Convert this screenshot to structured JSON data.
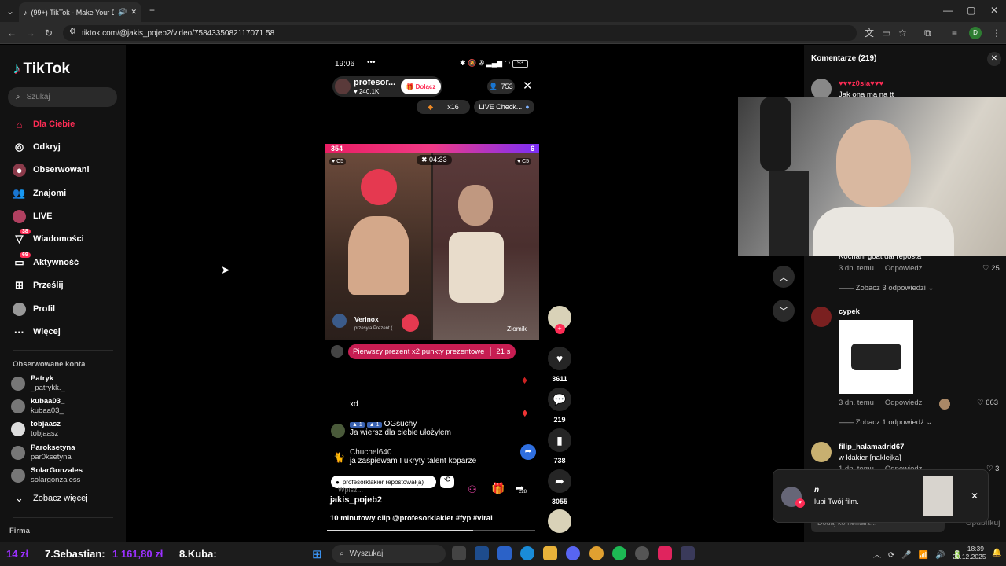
{
  "browser": {
    "tab_title": "(99+) TikTok - Make Your Da",
    "url": "tiktok.com/@jakis_pojeb2/video/7584335082117071 58",
    "new_tab": "+"
  },
  "sidebar": {
    "logo": "TikTok",
    "search_placeholder": "Szukaj",
    "nav": [
      {
        "label": "Dla Ciebie"
      },
      {
        "label": "Odkryj"
      },
      {
        "label": "Obserwowani"
      },
      {
        "label": "Znajomi"
      },
      {
        "label": "LIVE"
      },
      {
        "label": "Wiadomości",
        "badge": "38"
      },
      {
        "label": "Aktywność",
        "badge": "69"
      },
      {
        "label": "Prześlij"
      },
      {
        "label": "Profil"
      },
      {
        "label": "Więcej"
      }
    ],
    "followed_title": "Obserwowane konta",
    "accounts": [
      {
        "name": "Patryk",
        "user": "_patrykk._"
      },
      {
        "name": "kubaa03_",
        "user": "kubaa03_"
      },
      {
        "name": "tobjaasz",
        "user": "tobjaasz"
      },
      {
        "name": "Paroksetyna",
        "user": "par0ksetyna"
      },
      {
        "name": "SolarGonzales",
        "user": "solargonzaless"
      }
    ],
    "see_more": "Zobacz więcej",
    "company": "Firma"
  },
  "phone": {
    "time": "19:06",
    "dots": "•••",
    "battery": "93",
    "streamer": "profesor...",
    "likes": "240.1K",
    "join": "Dołącz",
    "viewers": "753",
    "gift_count": "x16",
    "live_check": "LIVE Check...",
    "score": "354",
    "right_score": "6",
    "timer": "04:33",
    "left_name": "Verinox",
    "left_sub": "przesyła Prezent (...",
    "right_name": "Ziomik",
    "banner": "Pierwszy prezent x2 punkty prezentowe",
    "banner_time": "21 s",
    "chat": [
      {
        "user": "",
        "text": "xd"
      },
      {
        "user": "OGsuchy",
        "text": "Ja wiersz dla ciebie ułożyłem"
      },
      {
        "user": "Chuchel640",
        "text": "ja zaśpiewam I ukryty talent koparze"
      }
    ],
    "repost_note": "profesorklakier repostował(a)",
    "write": "Wpisz...",
    "share_count": "228"
  },
  "video_info": {
    "author": "jakis_pojeb2",
    "description": "10 minutowy clip @profesorklakier #fyp #viral"
  },
  "actions": {
    "likes": "3611",
    "comments": "219",
    "saves": "738",
    "shares": "3055"
  },
  "comments": {
    "title": "Komentarze (219)",
    "first_user": "♥♥♥z0sia♥♥♥",
    "first_text": "Jak ona ma na tt",
    "hidden_text": "Kochani goat dał reposta",
    "c1_time": "3 dn. temu",
    "reply": "Odpowiedz",
    "c1_likes": "25",
    "c1_more": "Zobacz 3 odpowiedzi",
    "c2_user": "cypek",
    "c2_time": "3 dn. temu",
    "c2_likes": "663",
    "c2_more": "Zobacz 1 odpowiedź",
    "c3_user": "filip_halamadrid67",
    "c3_text": "w klakier [naklejka]",
    "c3_time": "1 dn. temu",
    "c3_likes": "3",
    "add_placeholder": "Dodaj komentarz...",
    "post": "Opublikuj"
  },
  "notification": {
    "user": "n",
    "text": "lubi Twój film."
  },
  "overlay": {
    "left_amount": "14 zł",
    "rank7": "7.Sebastian:",
    "rank7_amount": "1 161,80 zł",
    "rank8": "8.Kuba:"
  },
  "taskbar": {
    "search": "Wyszukaj",
    "time": "18:39",
    "date": "20.12.2025"
  },
  "colors": {
    "accent": "#fe2c55",
    "bg": "#121212"
  }
}
